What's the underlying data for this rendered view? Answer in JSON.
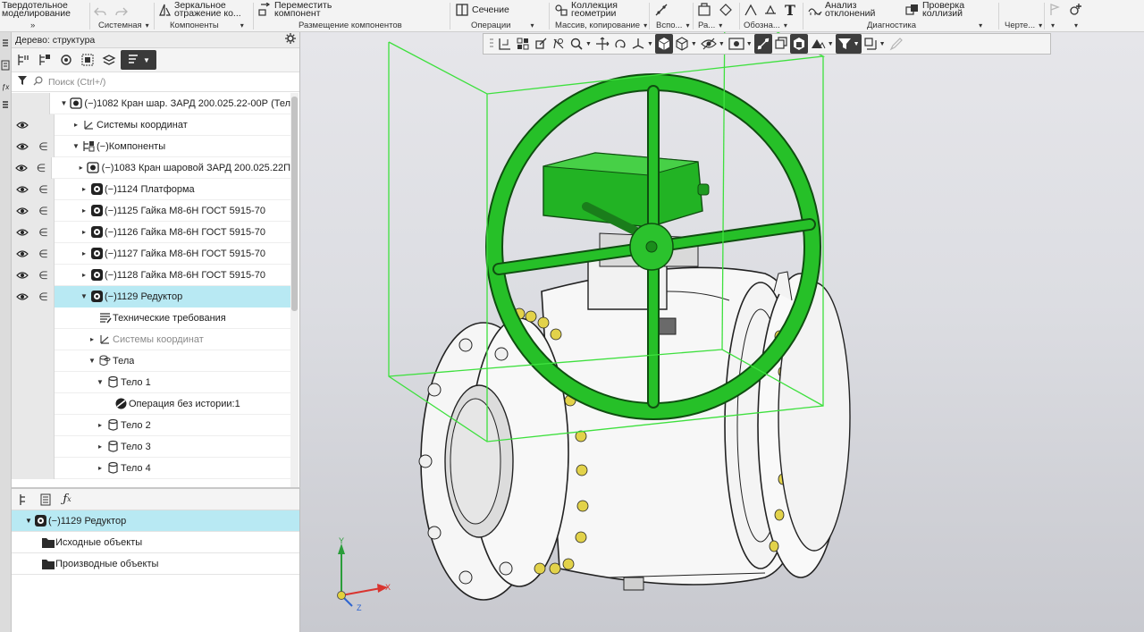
{
  "ribbon": {
    "groups": [
      {
        "label": "Системная",
        "buttons": [
          {
            "label": "Твердотельное\nмоделирование",
            "icon": "solid-modeling-icon"
          }
        ]
      },
      {
        "label": "Компоненты",
        "buttons": [
          {
            "label": "Зеркальное\nотражение ко...",
            "icon": "mirror-component-icon"
          }
        ]
      },
      {
        "label": "Размещение компонентов",
        "buttons": [
          {
            "label": "Переместить\nкомпонент",
            "icon": "move-component-icon"
          }
        ]
      },
      {
        "label": "Операции",
        "buttons": [
          {
            "label": "Сечение",
            "icon": "section-icon"
          }
        ]
      },
      {
        "label": "Массив, копирование",
        "buttons": [
          {
            "label": "Коллекция\nгеометрии",
            "icon": "geometry-collection-icon"
          }
        ]
      },
      {
        "label": "Вспо...",
        "buttons": []
      },
      {
        "label": "Ра...",
        "buttons": []
      },
      {
        "label": "Обозна...",
        "buttons": []
      },
      {
        "label": "Диагностика",
        "buttons": [
          {
            "label": "Анализ\nотклонений",
            "icon": "deviation-analysis-icon"
          },
          {
            "label": "Проверка\nколлизий",
            "icon": "collision-check-icon"
          }
        ]
      },
      {
        "label": "Черте...",
        "buttons": []
      }
    ],
    "collapse_glyph": "»"
  },
  "tree": {
    "title": "Дерево: структура",
    "search_placeholder": "Поиск (Ctrl+/)",
    "rows": [
      {
        "text": "(−)1082 Кран шар. ЗАРД 200.025.22-00Р (Тел",
        "indent": 0,
        "twisty": "▼",
        "icon": "assembly-icon",
        "eye": false,
        "inc": false
      },
      {
        "text": "Системы координат",
        "indent": 1,
        "twisty": "▸",
        "icon": "coordinate-system-icon",
        "eye": true,
        "inc": false
      },
      {
        "text": "(−)Компоненты",
        "indent": 1,
        "twisty": "▼",
        "icon": "components-icon",
        "eye": true,
        "inc": true
      },
      {
        "text": "(−)1083 Кран шаровой ЗАРД 200.025.22П",
        "indent": 2,
        "twisty": "▸",
        "icon": "assembly-icon",
        "eye": true,
        "inc": true
      },
      {
        "text": "(−)1124 Платформа",
        "indent": 2,
        "twisty": "▸",
        "icon": "part-icon",
        "eye": true,
        "inc": true
      },
      {
        "text": "(−)1125 Гайка М8-6Н ГОСТ 5915-70",
        "indent": 2,
        "twisty": "▸",
        "icon": "part-icon",
        "eye": true,
        "inc": true
      },
      {
        "text": "(−)1126 Гайка М8-6Н ГОСТ 5915-70",
        "indent": 2,
        "twisty": "▸",
        "icon": "part-icon",
        "eye": true,
        "inc": true
      },
      {
        "text": "(−)1127 Гайка М8-6Н ГОСТ 5915-70",
        "indent": 2,
        "twisty": "▸",
        "icon": "part-icon",
        "eye": true,
        "inc": true
      },
      {
        "text": "(−)1128 Гайка М8-6Н ГОСТ 5915-70",
        "indent": 2,
        "twisty": "▸",
        "icon": "part-icon",
        "eye": true,
        "inc": true
      },
      {
        "text": "(−)1129 Редуктор",
        "indent": 2,
        "twisty": "▼",
        "icon": "part-icon",
        "eye": true,
        "inc": true,
        "selected": true
      },
      {
        "text": "Технические требования",
        "indent": 3,
        "twisty": "",
        "icon": "tech-requirements-icon",
        "eye": false,
        "inc": false
      },
      {
        "text": "Системы координат",
        "indent": 3,
        "twisty": "▸",
        "icon": "coordinate-system-icon",
        "eye": false,
        "inc": false,
        "grey": true
      },
      {
        "text": "Тела",
        "indent": 3,
        "twisty": "▼",
        "icon": "bodies-icon",
        "eye": false,
        "inc": false
      },
      {
        "text": "Тело 1",
        "indent": 4,
        "twisty": "▼",
        "icon": "body-icon",
        "eye": false,
        "inc": false
      },
      {
        "text": "Операция без истории:1",
        "indent": 5,
        "twisty": "",
        "icon": "operation-icon",
        "eye": false,
        "inc": false
      },
      {
        "text": "Тело 2",
        "indent": 4,
        "twisty": "▸",
        "icon": "body-icon",
        "eye": false,
        "inc": false
      },
      {
        "text": "Тело 3",
        "indent": 4,
        "twisty": "▸",
        "icon": "body-icon",
        "eye": false,
        "inc": false
      },
      {
        "text": "Тело 4",
        "indent": 4,
        "twisty": "▸",
        "icon": "body-icon",
        "eye": false,
        "inc": false
      }
    ]
  },
  "bottom_panel": {
    "rows": [
      {
        "text": "(−)1129 Редуктор",
        "icon": "part-icon",
        "twisty": "▼",
        "selected": true
      },
      {
        "text": "Исходные объекты",
        "icon": "folder-icon",
        "twisty": ""
      },
      {
        "text": "Производные объекты",
        "icon": "folder-icon",
        "twisty": ""
      }
    ]
  },
  "axes": {
    "x": "X",
    "y": "Y",
    "z": "Z"
  },
  "colors": {
    "highlight": "#21b022",
    "selection_row": "#b8e9f3",
    "bounding_box": "#3ee03e"
  }
}
